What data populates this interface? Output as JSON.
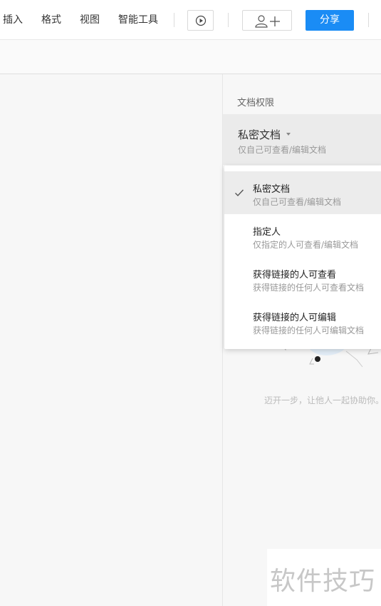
{
  "toolbar": {
    "menu": [
      "插入",
      "格式",
      "视图",
      "智能工具"
    ],
    "share_label": "分享"
  },
  "panel": {
    "title": "文档权限",
    "current": {
      "name": "私密文档",
      "desc": "仅自己可查看/编辑文档"
    },
    "empty_hint": "迈开一步，让他人一起协助你。"
  },
  "dropdown": {
    "options": [
      {
        "label": "私密文档",
        "desc": "仅自己可查看/编辑文档",
        "selected": true
      },
      {
        "label": "指定人",
        "desc": "仅指定的人可查看/编辑文档",
        "selected": false
      },
      {
        "label": "获得链接的人可查看",
        "desc": "获得链接的任何人可查看文档",
        "selected": false
      },
      {
        "label": "获得链接的人可编辑",
        "desc": "获得链接的任何人可编辑文档",
        "selected": false
      }
    ]
  },
  "watermark": {
    "text": "软件技巧"
  },
  "colors": {
    "accent": "#1a8cf5",
    "selected_bg": "#ececec"
  },
  "icons": [
    "play-icon",
    "add-user-icon",
    "check-icon",
    "caret-down-icon"
  ]
}
